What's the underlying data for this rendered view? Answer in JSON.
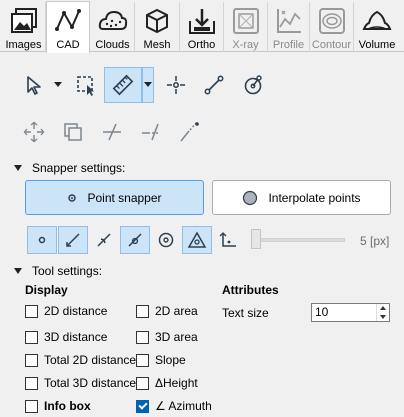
{
  "tabs": [
    {
      "label": "Images",
      "icon": "images-icon",
      "active": false,
      "disabled": false
    },
    {
      "label": "CAD",
      "icon": "cad-icon",
      "active": true,
      "disabled": false
    },
    {
      "label": "Clouds",
      "icon": "clouds-icon",
      "active": false,
      "disabled": false
    },
    {
      "label": "Mesh",
      "icon": "mesh-cube-icon",
      "active": false,
      "disabled": false
    },
    {
      "label": "Ortho",
      "icon": "ortho-icon",
      "active": false,
      "disabled": false
    },
    {
      "label": "X-ray",
      "icon": "xray-icon",
      "active": false,
      "disabled": true
    },
    {
      "label": "Profile",
      "icon": "profile-icon",
      "active": false,
      "disabled": true
    },
    {
      "label": "Contour",
      "icon": "contour-icon",
      "active": false,
      "disabled": true
    },
    {
      "label": "Volume",
      "icon": "volume-icon",
      "active": false,
      "disabled": false
    }
  ],
  "snapper": {
    "header": "Snapper settings:",
    "point_snapper": "Point snapper",
    "interpolate_points": "Interpolate points",
    "slider_value": "5 [px]"
  },
  "tool_settings": {
    "header": "Tool settings:",
    "display_title": "Display",
    "attributes_title": "Attributes",
    "text_size_label": "Text size",
    "text_size_value": "10",
    "col1": [
      "2D distance",
      "3D distance",
      "Total 2D distance",
      "Total 3D distance",
      "Info box"
    ],
    "col2": [
      "2D area",
      "3D area",
      "Slope",
      "ΔHeight",
      "∠ Azimuth"
    ]
  },
  "colors": {
    "accent": "#cce4f7",
    "accent_border": "#569de5",
    "icon": "#2c3e50"
  }
}
